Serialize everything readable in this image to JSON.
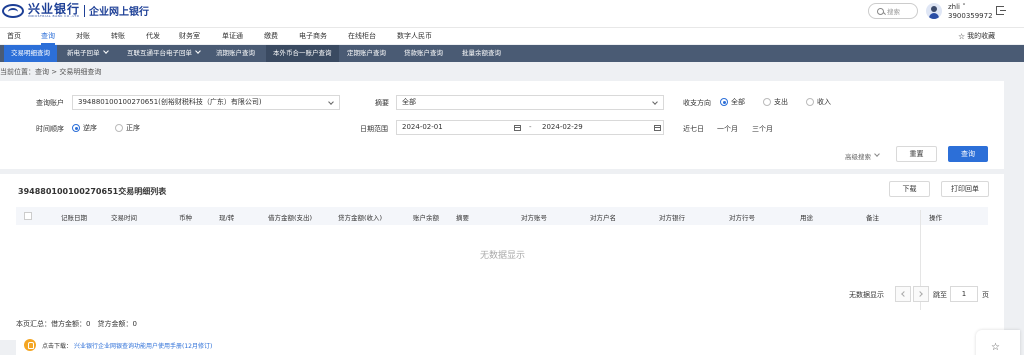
{
  "header": {
    "logo_cn": "兴业银行",
    "logo_en": "INDUSTRIAL BANK CO.,LTD",
    "logo_sub": "企业网上银行",
    "search_placeholder": "搜索",
    "user_name": "zhli",
    "user_phone": "3900359972"
  },
  "main_nav": {
    "items": [
      "首页",
      "查询",
      "对账",
      "转账",
      "代发",
      "财务室",
      "单证通",
      "缴费",
      "电子商务",
      "在线柜台",
      "数字人民币"
    ],
    "active_index": 1,
    "favorites": "我的收藏"
  },
  "sub_nav": {
    "tabs": [
      "交易明细查询",
      "新电子回单",
      "互联互通平台电子回单",
      "流期账户查询",
      "本外币合一账户查询",
      "定期账户查询",
      "贷款账户查询",
      "批量余额查询"
    ],
    "active_index": 0
  },
  "breadcrumb": "当前位置：查询 > 交易明细查询",
  "form": {
    "account_label": "查询账户",
    "account_value": "394880100100270651(创裕财税科技（广东）有限公司)",
    "summary_label": "摘要",
    "summary_value": "全部",
    "direction_label": "收支方向",
    "direction_options": [
      "全部",
      "支出",
      "收入"
    ],
    "direction_selected": "全部",
    "order_label": "时间顺序",
    "order_options": [
      "逆序",
      "正序"
    ],
    "order_selected": "逆序",
    "date_label": "日期范围",
    "date_start": "2024-02-01",
    "date_sep": "-",
    "date_end": "2024-02-29",
    "quick_ranges": [
      "近七日",
      "一个月",
      "三个月"
    ],
    "advanced": "高级搜索",
    "reset": "重置",
    "query": "查询"
  },
  "list": {
    "title": "394880100100270651交易明细列表",
    "download": "下载",
    "print": "打印回单",
    "columns": [
      "记账日期",
      "交易时间",
      "币种",
      "现/转",
      "借方金额(支出)",
      "贷方金额(收入)",
      "账户余额",
      "摘要",
      "对方账号",
      "对方户名",
      "对方银行",
      "对方行号",
      "用途",
      "备注",
      "操作"
    ],
    "empty_text": "无数据显示",
    "pager_text": "无数据显示",
    "jump_label": "跳至",
    "jump_value": "1",
    "page_unit": "页",
    "summary": "本页汇总：借方金额：0　贷方金额：0"
  },
  "notice": {
    "prefix": "点击下载：",
    "link": "兴业银行企业网银查询功能用户使用手册(12月修订)"
  },
  "colors": {
    "brand": "#1d3f96",
    "accent": "#2c6fd8",
    "subnav_bg": "#4a5b74"
  }
}
